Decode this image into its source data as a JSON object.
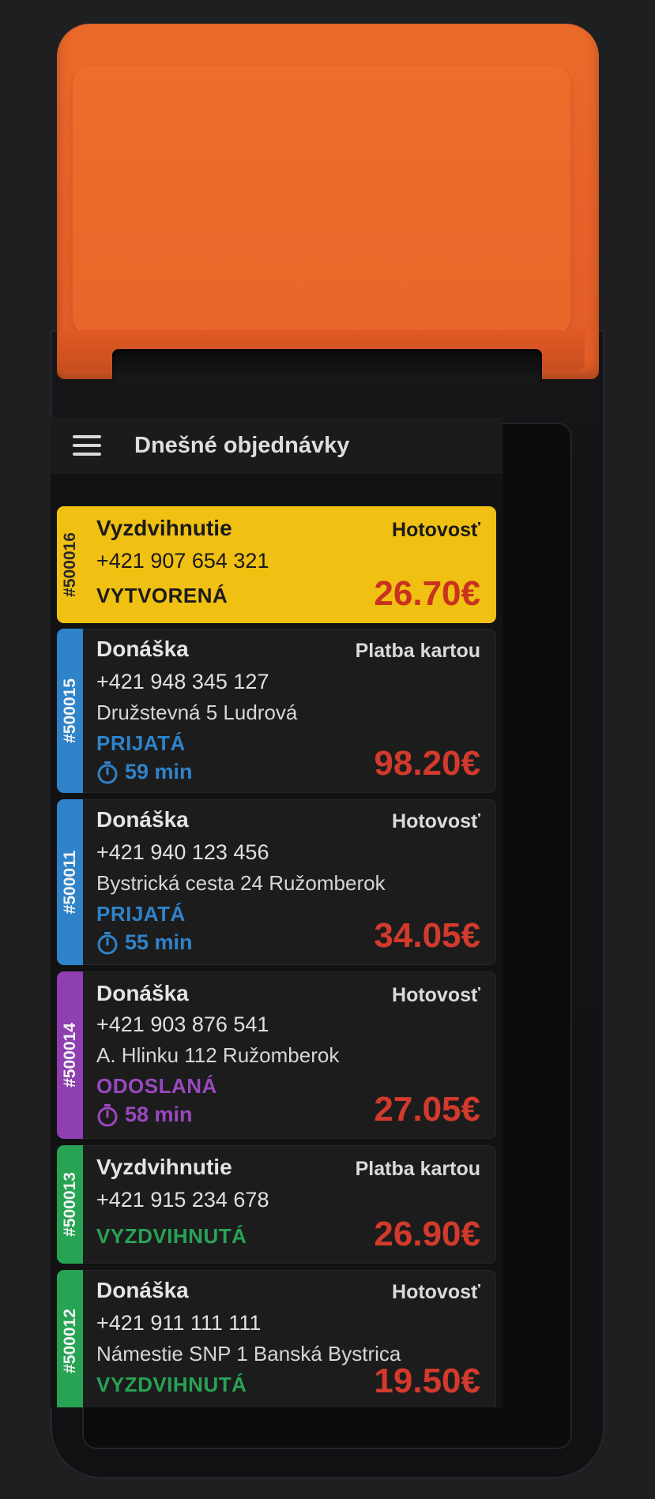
{
  "app": {
    "title": "Dnešné objednávky"
  },
  "colors": {
    "device_orange": "#e8632a",
    "highlight_yellow": "#f0c012",
    "blue": "#2f83c9",
    "purple": "#8e3fb0",
    "green": "#27a354",
    "price_red": "#d23a2c"
  },
  "orders": [
    {
      "id": "#500016",
      "type": "Vyzdvihnutie",
      "payment": "Hotovosť",
      "phone": "+421 907 654 321",
      "address": "",
      "status": "VYTVORENÁ",
      "timer": "",
      "price": "26.70€",
      "stripe_color": "#f0c012",
      "status_color": "#1a1a1a"
    },
    {
      "id": "#500015",
      "type": "Donáška",
      "payment": "Platba kartou",
      "phone": "+421 948 345 127",
      "address": "Družstevná 5 Ludrová",
      "status": "PRIJATÁ",
      "timer": "59 min",
      "price": "98.20€",
      "stripe_color": "#2f83c9",
      "status_color": "#2f83c9"
    },
    {
      "id": "#500011",
      "type": "Donáška",
      "payment": "Hotovosť",
      "phone": "+421 940 123 456",
      "address": "Bystrická cesta 24 Ružomberok",
      "status": "PRIJATÁ",
      "timer": "55 min",
      "price": "34.05€",
      "stripe_color": "#2f83c9",
      "status_color": "#2f83c9"
    },
    {
      "id": "#500014",
      "type": "Donáška",
      "payment": "Hotovosť",
      "phone": "+421 903 876 541",
      "address": "A. Hlinku 112 Ružomberok",
      "status": "ODOSLANÁ",
      "timer": "58 min",
      "price": "27.05€",
      "stripe_color": "#8e3fb0",
      "status_color": "#9a48be"
    },
    {
      "id": "#500013",
      "type": "Vyzdvihnutie",
      "payment": "Platba kartou",
      "phone": "+421 915 234 678",
      "address": "",
      "status": "VYZDVIHNUTÁ",
      "timer": "",
      "price": "26.90€",
      "stripe_color": "#27a354",
      "status_color": "#27a354"
    },
    {
      "id": "#500012",
      "type": "Donáška",
      "payment": "Hotovosť",
      "phone": "+421 911 111 111",
      "address": "Námestie SNP 1 Banská Bystrica",
      "status": "VYZDVIHNUTÁ",
      "timer": "",
      "price": "19.50€",
      "stripe_color": "#27a354",
      "status_color": "#27a354"
    }
  ]
}
